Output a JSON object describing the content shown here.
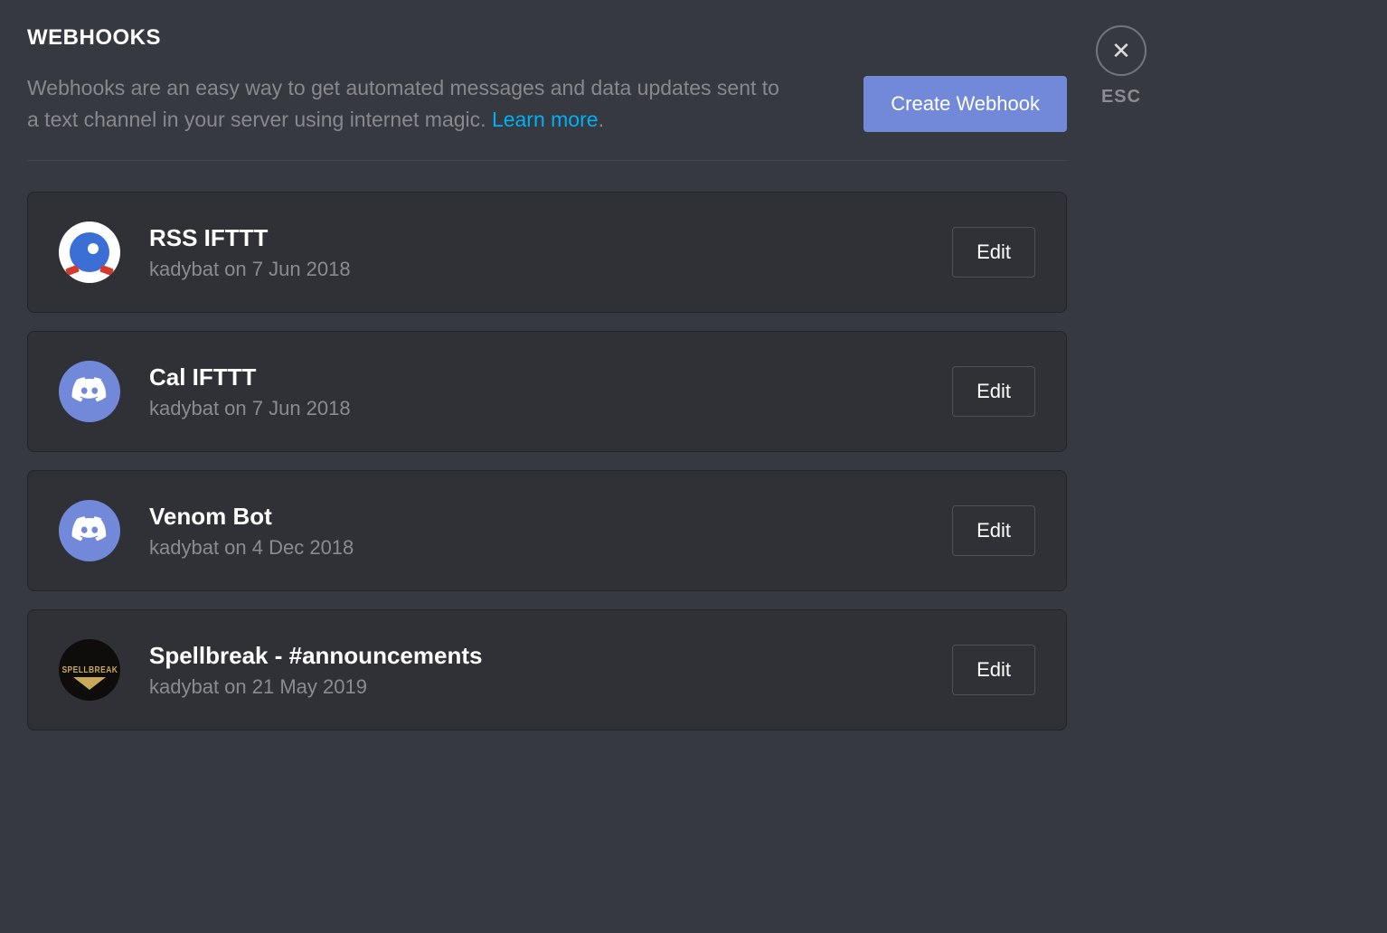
{
  "header": {
    "title": "WEBHOOKS",
    "description_prefix": "Webhooks are an easy way to get automated messages and data updates sent to a text channel in your server using internet magic. ",
    "learn_more": "Learn more",
    "description_suffix": ".",
    "create_button": "Create Webhook"
  },
  "close": {
    "icon_glyph": "✕",
    "esc_label": "ESC"
  },
  "edit_label": "Edit",
  "webhooks": [
    {
      "name": "RSS IFTTT",
      "meta": "kadybat on 7 Jun 2018",
      "avatar_type": "sonic"
    },
    {
      "name": "Cal IFTTT",
      "meta": "kadybat on 7 Jun 2018",
      "avatar_type": "discord"
    },
    {
      "name": "Venom Bot",
      "meta": "kadybat on 4 Dec 2018",
      "avatar_type": "discord"
    },
    {
      "name": "Spellbreak - #announcements",
      "meta": "kadybat on 21 May 2019",
      "avatar_type": "spellbreak"
    }
  ],
  "spellbreak_label": "SPELLBREAK"
}
